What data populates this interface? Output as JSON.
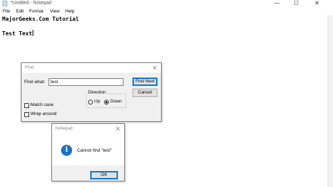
{
  "window": {
    "title": "*Untitled - Notepad",
    "controls": {
      "minimize": "—",
      "maximize": "☐",
      "close": "✕"
    }
  },
  "menu": [
    "File",
    "Edit",
    "Format",
    "View",
    "Help"
  ],
  "editor": {
    "lines": [
      "MajorGeeks.Com Tutorial",
      "",
      "Test Text"
    ]
  },
  "find_dialog": {
    "title": "Find",
    "find_what_label": "Find what:",
    "find_what_value": "test",
    "find_next_label": "Find Next",
    "cancel_label": "Cancel",
    "direction_label": "Direction",
    "up_label": "Up",
    "down_label": "Down",
    "direction_selected": "Down",
    "match_case_label": "Match case",
    "match_case_checked": false,
    "wrap_around_label": "Wrap around",
    "wrap_around_checked": false,
    "close": "✕"
  },
  "message_box": {
    "title": "Notepad",
    "message": "Cannot find \"test\"",
    "icon": "info-icon",
    "icon_glyph": "i",
    "ok_label": "OK",
    "close": "✕"
  },
  "colors": {
    "accent": "#0078d7",
    "info_icon": "#1c73c3",
    "dialog_bg": "#f0f0f0"
  }
}
